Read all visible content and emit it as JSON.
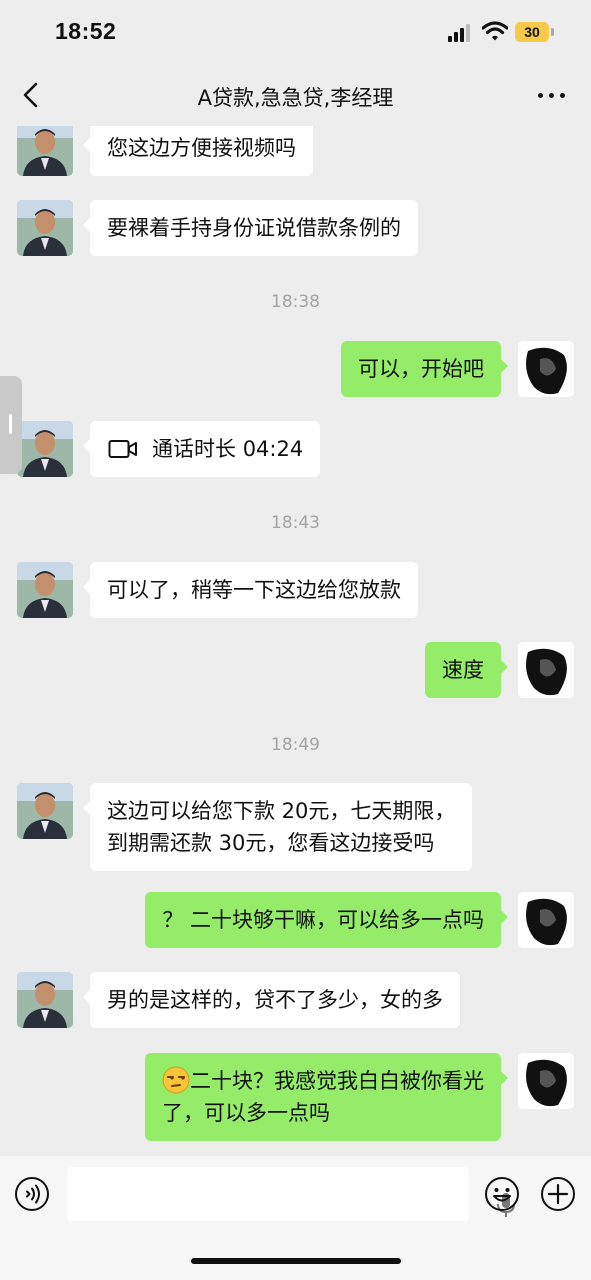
{
  "status_bar": {
    "time": "18:52",
    "battery": "30"
  },
  "header": {
    "title": "A贷款,急急贷,李经理"
  },
  "messages": [
    {
      "side": "in",
      "text": "您这边方便接视频吗"
    },
    {
      "side": "in",
      "text": "要裸着手持身份证说借款条例的"
    },
    {
      "type": "time",
      "text": "18:38"
    },
    {
      "side": "out",
      "text": "可以，开始吧"
    },
    {
      "side": "in",
      "type": "call",
      "call_label": "通话时长",
      "call_duration": "04:24"
    },
    {
      "type": "time",
      "text": "18:43"
    },
    {
      "side": "in",
      "text": "可以了，稍等一下这边给您放款"
    },
    {
      "side": "out",
      "text": "速度"
    },
    {
      "type": "time",
      "text": "18:49"
    },
    {
      "side": "in",
      "line1": "这边可以给您下款 20元，七天期限，",
      "line2": "到期需还款 30元，您看这边接受吗"
    },
    {
      "side": "out",
      "text": "？ 二十块够干嘛，可以给多一点吗"
    },
    {
      "side": "in",
      "text": "男的是这样的，贷不了多少，女的多"
    },
    {
      "side": "out",
      "emoji": "unamused-face",
      "line1": "二十块？我感觉我白白被你看光",
      "line2": "了，可以多一点吗"
    }
  ],
  "input_bar": {
    "voice_icon": "voice-icon",
    "mic_icon": "mic-icon",
    "emoji_icon": "emoji-icon",
    "plus_icon": "plus-icon"
  },
  "colors": {
    "background": "#ededed",
    "outgoing_bubble": "#95ec69",
    "incoming_bubble": "#ffffff",
    "timestamp": "#a4a4a4"
  }
}
